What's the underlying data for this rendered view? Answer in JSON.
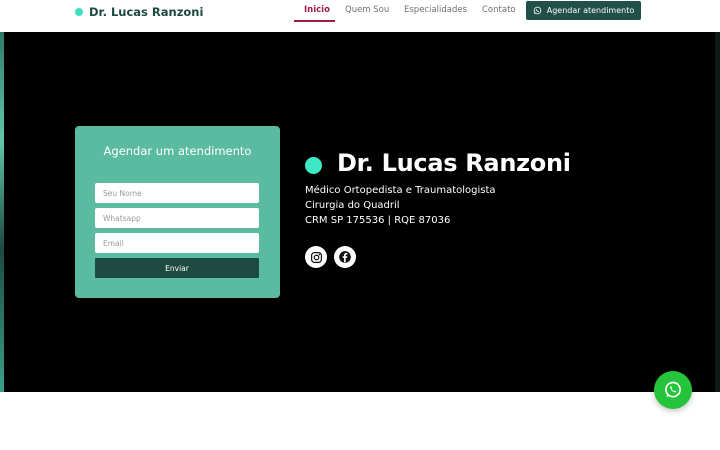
{
  "header": {
    "brand": "Dr. Lucas Ranzoni",
    "nav": [
      {
        "label": "Inicio",
        "active": true
      },
      {
        "label": "Quem Sou",
        "active": false
      },
      {
        "label": "Especialidades",
        "active": false
      },
      {
        "label": "Contato",
        "active": false
      }
    ],
    "cta_label": "Agendar atendimento"
  },
  "form": {
    "title": "Agendar um atendimento",
    "name_placeholder": "Seu Nome",
    "whatsapp_placeholder": "Whatsapp",
    "email_placeholder": "Email",
    "submit_label": "Enviar"
  },
  "hero": {
    "name": "Dr. Lucas Ranzoni",
    "specialty": "Médico Ortopedista e Traumatologista",
    "subspecialty": "Cirurgia do Quadril",
    "registration": "CRM SP 175536 | RQE 87036"
  },
  "social": {
    "icons": [
      "instagram-icon",
      "facebook-icon"
    ]
  },
  "floating": {
    "icon": "whatsapp-icon"
  },
  "colors": {
    "brand_dark": "#215048",
    "accent_teal": "#3de0c0",
    "card_bg": "#5bbba1",
    "active_nav": "#a01a4a",
    "whatsapp_green": "#25c43a",
    "hero_bg": "#000000"
  }
}
